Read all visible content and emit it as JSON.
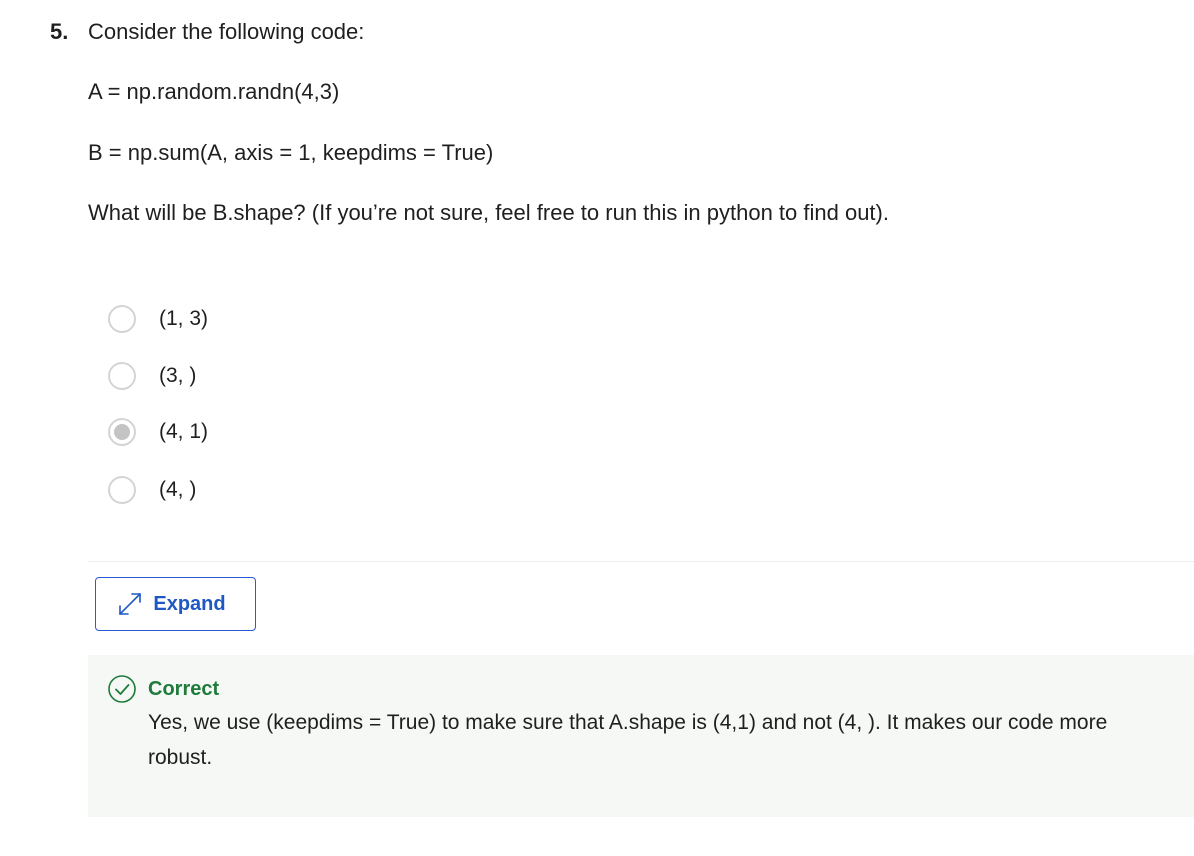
{
  "question": {
    "number": "5.",
    "prompt": "Consider the following code:",
    "code_line_1": "A = np.random.randn(4,3)",
    "code_line_2": "B = np.sum(A, axis = 1, keepdims = True)",
    "ask": "What will be B.shape? (If you’re not sure, feel free to run this in python to find out)."
  },
  "options": [
    {
      "label": "(1, 3)",
      "selected": false
    },
    {
      "label": "(3, )",
      "selected": false
    },
    {
      "label": "(4, 1)",
      "selected": true
    },
    {
      "label": "(4, )",
      "selected": false
    }
  ],
  "expand": {
    "label": "Expand",
    "icon": "expand-arrows-icon"
  },
  "feedback": {
    "status": "Correct",
    "icon": "check-circle-icon",
    "text": "Yes, we use (keepdims = True) to make sure that A.shape is (4,1) and not (4, ). It makes our code more robust."
  },
  "colors": {
    "accent": "#1f57c3",
    "correct": "#1e7b3c",
    "feedback_bg": "#f5f8f5",
    "radio_border": "#d4d4d4"
  }
}
